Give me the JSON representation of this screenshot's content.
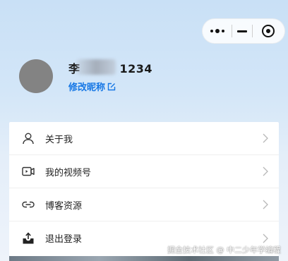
{
  "profile": {
    "nickname": "1234",
    "edit_nickname_label": "修改昵称"
  },
  "capsule": {
    "more_icon": "more-dots-icon",
    "minimize_icon": "minimize-icon",
    "close_icon": "close-target-icon"
  },
  "menu": {
    "items": [
      {
        "label": "关于我",
        "icon": "person-icon"
      },
      {
        "label": "我的视频号",
        "icon": "video-channel-icon"
      },
      {
        "label": "博客资源",
        "icon": "link-icon"
      },
      {
        "label": "退出登录",
        "icon": "logout-tray-icon"
      }
    ]
  },
  "watermark": "掘金技术社区 @ 中二少年学编程",
  "colors": {
    "accent": "#1677e5",
    "background_top": "#c9e0f6",
    "avatar": "#838383"
  }
}
